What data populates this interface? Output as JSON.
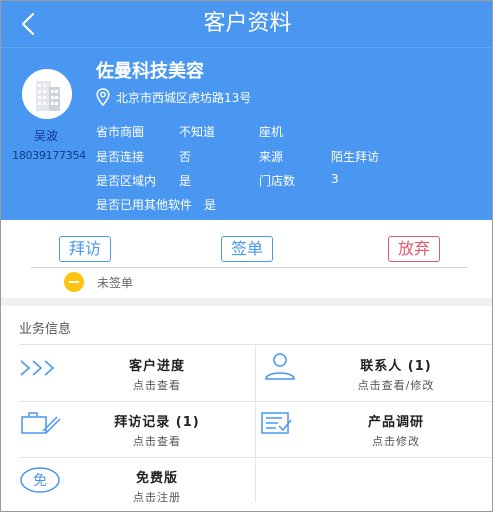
{
  "header": {
    "title": "客户资料"
  },
  "profile": {
    "owner_name": "吴波",
    "owner_phone": "18039177354",
    "company": "佐曼科技美容",
    "address": "北京市西城区虎坊路13号",
    "fields": {
      "r1c1": "省市商圈",
      "r1c2": "不知道",
      "r1c3": "座机",
      "r2c1": "是否连接",
      "r2c2": "否",
      "r2c3": "来源",
      "r2c4": "陌生拜访",
      "r3c1": "是否区域内",
      "r3c2": "是",
      "r3c3": "门店数",
      "r3c4": "3",
      "r4c1": "是否已用其他软件",
      "r4c2": "是"
    }
  },
  "actions": {
    "visit": "拜访",
    "sign": "签单",
    "abandon": "放弃",
    "status": "未签单"
  },
  "business": {
    "title": "业务信息",
    "items": [
      {
        "label": "客户进度",
        "sub": "点击查看"
      },
      {
        "label": "联系人 (1)",
        "sub": "点击查看/修改"
      },
      {
        "label": "拜访记录 (1)",
        "sub": "点击查看"
      },
      {
        "label": "产品调研",
        "sub": "点击修改"
      },
      {
        "label": "免费版",
        "sub": "点击注册",
        "icon_text": "免"
      }
    ]
  },
  "colors": {
    "primary": "#4a97f2",
    "danger": "#e05a6b",
    "status": "#ffc310"
  }
}
